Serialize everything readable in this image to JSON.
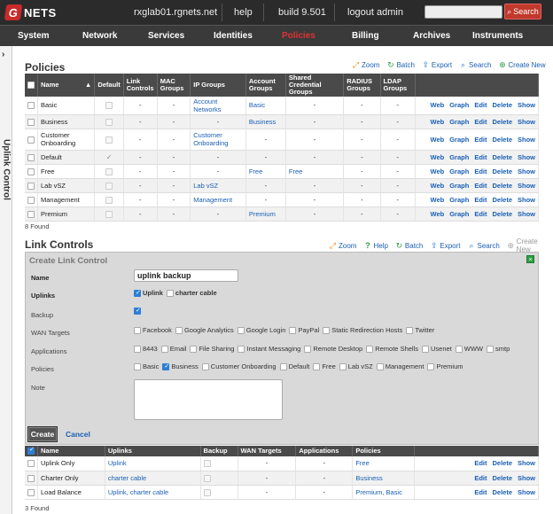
{
  "brand": {
    "mark": "G",
    "name": "NETS"
  },
  "topnav": {
    "host": "rxglab01.rgnets.net",
    "help": "help",
    "build": "build 9.501",
    "logout": "logout admin"
  },
  "search": {
    "placeholder": "",
    "button": "Search"
  },
  "mainnav": [
    "System",
    "Network",
    "Services",
    "Identities",
    "Policies",
    "Billing",
    "Archives",
    "Instruments"
  ],
  "active_nav": "Policies",
  "sidebar": {
    "label": "Uplink Control"
  },
  "policies": {
    "title": "Policies",
    "actions": [
      "Zoom",
      "Batch",
      "Export",
      "Search",
      "Create New"
    ],
    "headers": [
      "Name",
      "Default",
      "Link Controls",
      "MAC Groups",
      "IP Groups",
      "Account Groups",
      "Shared Credential Groups",
      "RADIUS Groups",
      "LDAP Groups"
    ],
    "rows": [
      {
        "name": "Basic",
        "default": false,
        "link": "-",
        "mac": "-",
        "ip": "Account Networks",
        "acct": "Basic",
        "shared": "-",
        "radius": "-",
        "ldap": "-"
      },
      {
        "name": "Business",
        "default": false,
        "link": "-",
        "mac": "-",
        "ip": "-",
        "acct": "Business",
        "shared": "-",
        "radius": "-",
        "ldap": "-"
      },
      {
        "name": "Customer Onboarding",
        "default": false,
        "link": "-",
        "mac": "-",
        "ip": "Customer Onboarding",
        "acct": "-",
        "shared": "-",
        "radius": "-",
        "ldap": "-"
      },
      {
        "name": "Default",
        "default": true,
        "link": "-",
        "mac": "-",
        "ip": "-",
        "acct": "-",
        "shared": "-",
        "radius": "-",
        "ldap": "-"
      },
      {
        "name": "Free",
        "default": false,
        "link": "-",
        "mac": "-",
        "ip": "-",
        "acct": "Free",
        "shared": "Free",
        "radius": "-",
        "ldap": "-"
      },
      {
        "name": "Lab vSZ",
        "default": false,
        "link": "-",
        "mac": "-",
        "ip": "Lab vSZ",
        "acct": "-",
        "shared": "-",
        "radius": "-",
        "ldap": "-"
      },
      {
        "name": "Management",
        "default": false,
        "link": "-",
        "mac": "-",
        "ip": "Management",
        "acct": "-",
        "shared": "-",
        "radius": "-",
        "ldap": "-"
      },
      {
        "name": "Premium",
        "default": false,
        "link": "-",
        "mac": "-",
        "ip": "-",
        "acct": "Premium",
        "shared": "-",
        "radius": "-",
        "ldap": "-"
      }
    ],
    "row_actions": [
      "Web",
      "Graph",
      "Edit",
      "Delete",
      "Show"
    ],
    "found": "8 Found"
  },
  "link_controls": {
    "title": "Link Controls",
    "actions": [
      "Zoom",
      "Help",
      "Batch",
      "Export",
      "Search",
      "Create New"
    ],
    "form": {
      "title": "Create Link Control",
      "name_label": "Name",
      "name_value": "uplink backup",
      "uplinks_label": "Uplinks",
      "uplinks": [
        {
          "label": "Uplink",
          "checked": true
        },
        {
          "label": "charter cable",
          "checked": false
        }
      ],
      "backup_label": "Backup",
      "wan_label": "WAN Targets",
      "wan_targets": [
        "Facebook",
        "Google Analytics",
        "Google Login",
        "PayPal",
        "Static Redirection Hosts",
        "Twitter"
      ],
      "apps_label": "Applications",
      "applications": [
        "8443",
        "Email",
        "File Sharing",
        "Instant Messaging",
        "Remote Desktop",
        "Remote Shells",
        "Usenet",
        "WWW",
        "smtp"
      ],
      "policies_label": "Policies",
      "policies": [
        {
          "label": "Basic",
          "checked": false
        },
        {
          "label": "Business",
          "checked": true
        },
        {
          "label": "Customer Onboarding",
          "checked": false
        },
        {
          "label": "Default",
          "checked": false
        },
        {
          "label": "Free",
          "checked": false
        },
        {
          "label": "Lab vSZ",
          "checked": false
        },
        {
          "label": "Management",
          "checked": false
        },
        {
          "label": "Premium",
          "checked": false
        }
      ],
      "note_label": "Note",
      "create": "Create",
      "cancel": "Cancel"
    },
    "headers": [
      "Name",
      "Uplinks",
      "Backup",
      "WAN Targets",
      "Applications",
      "Policies"
    ],
    "rows": [
      {
        "name": "Uplink Only",
        "uplinks": "Uplink",
        "wan": "-",
        "apps": "-",
        "policies": "Free"
      },
      {
        "name": "Charter Only",
        "uplinks": "charter cable",
        "wan": "-",
        "apps": "-",
        "policies": "Business"
      },
      {
        "name": "Load Balance",
        "uplinks": "Uplink, charter cable",
        "wan": "-",
        "apps": "-",
        "policies": "Premium, Basic"
      }
    ],
    "row_actions": [
      "Edit",
      "Delete",
      "Show"
    ],
    "found": "3 Found"
  }
}
